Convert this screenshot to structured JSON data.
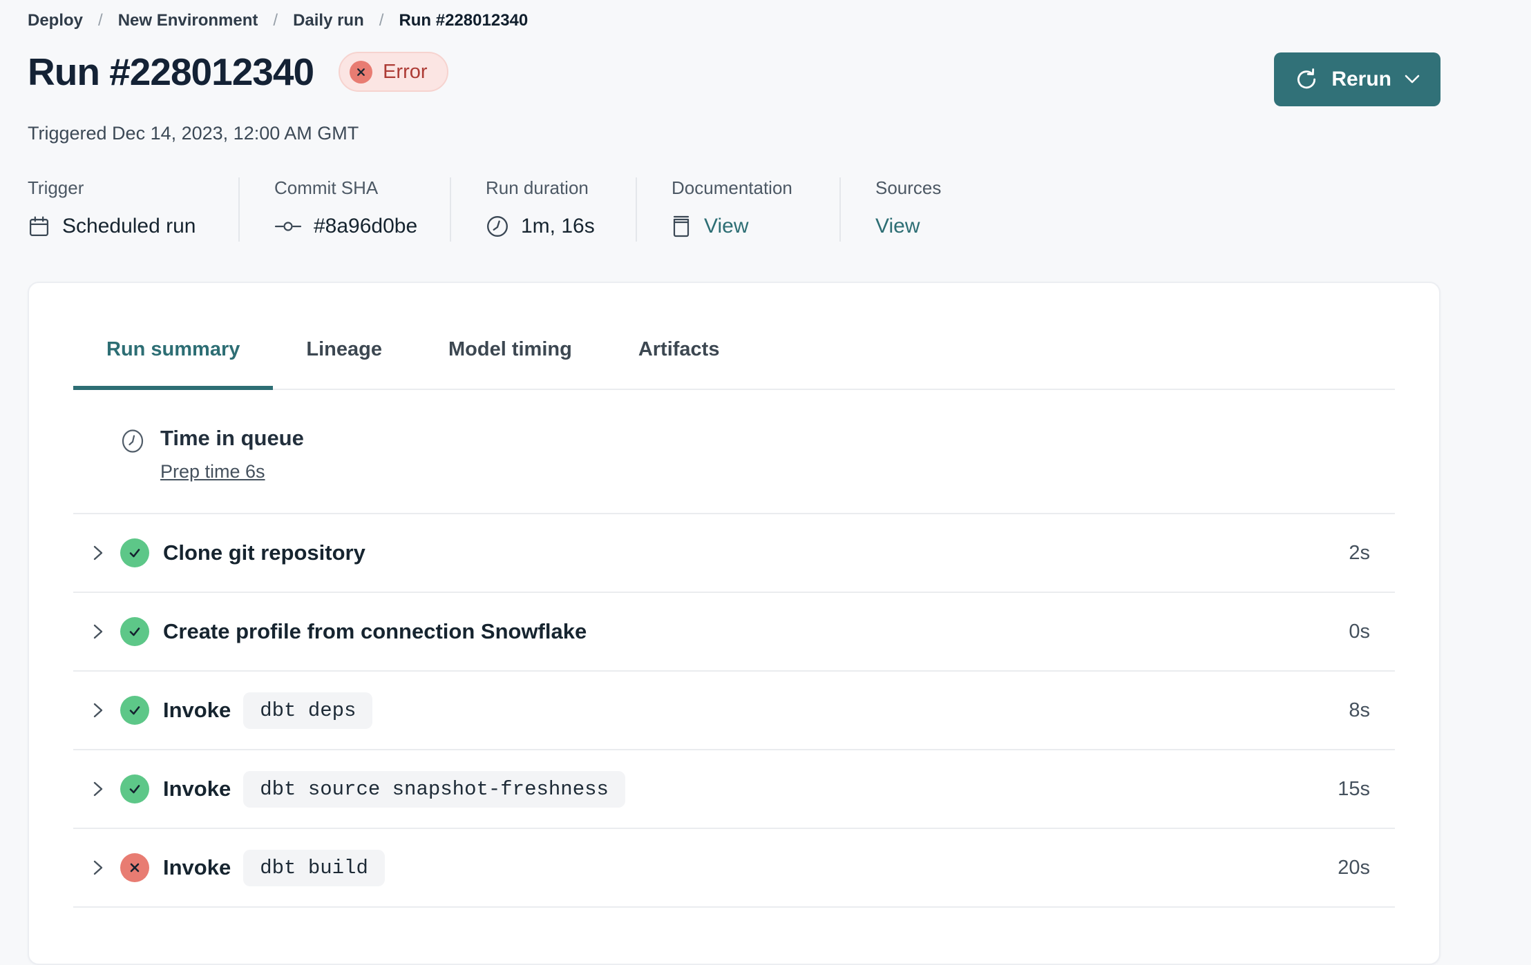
{
  "breadcrumb": {
    "separator": "/",
    "items": [
      {
        "label": "Deploy"
      },
      {
        "label": "New Environment"
      },
      {
        "label": "Daily run"
      },
      {
        "label": "Run #228012340",
        "current": true
      }
    ]
  },
  "header": {
    "title": "Run #228012340",
    "status": {
      "label": "Error",
      "icon": "x-circle-icon"
    },
    "triggered": "Triggered Dec 14, 2023, 12:00 AM GMT",
    "rerun": {
      "label": "Rerun",
      "icon": "refresh-icon",
      "chevron": "chevron-down-icon"
    }
  },
  "meta": {
    "columns": [
      {
        "label": "Trigger",
        "value": "Scheduled run",
        "icon": "calendar-icon"
      },
      {
        "label": "Commit SHA",
        "value": "#8a96d0be",
        "icon": "commit-icon"
      },
      {
        "label": "Run duration",
        "value": "1m, 16s",
        "icon": "clock-icon"
      },
      {
        "label": "Documentation",
        "value": "View",
        "icon": "book-icon",
        "link": true
      },
      {
        "label": "Sources",
        "value": "View",
        "icon": null,
        "link": true
      }
    ]
  },
  "tabs": {
    "items": [
      {
        "label": "Run summary",
        "active": true
      },
      {
        "label": "Lineage",
        "active": false
      },
      {
        "label": "Model timing",
        "active": false
      },
      {
        "label": "Artifacts",
        "active": false
      }
    ]
  },
  "run_summary": {
    "queue": {
      "title": "Time in queue",
      "link_label": "Prep time 6s",
      "icon": "clock-icon"
    },
    "steps": [
      {
        "name": "Clone git repository",
        "status": "success",
        "duration": "2s"
      },
      {
        "name": "Create profile from connection Snowflake",
        "status": "success",
        "duration": "0s"
      },
      {
        "name": "Invoke",
        "command": "dbt deps",
        "status": "success",
        "duration": "8s"
      },
      {
        "name": "Invoke",
        "command": "dbt source snapshot-freshness",
        "status": "success",
        "duration": "15s"
      },
      {
        "name": "Invoke",
        "command": "dbt build",
        "status": "error",
        "duration": "20s"
      }
    ]
  },
  "colors": {
    "teal": "#2d6e74",
    "button_teal": "#317178",
    "success_green": "#5dc788",
    "error_red": "#e87c72",
    "error_badge_bg": "#fbe5e3",
    "error_badge_border": "#f6d3cf",
    "error_badge_text": "#ad3b35",
    "navy": "#16242f",
    "gray_label": "#4c5864",
    "divider": "#eaecef",
    "code_bg": "#f3f4f6",
    "page_bg": "#f7f8fa"
  }
}
